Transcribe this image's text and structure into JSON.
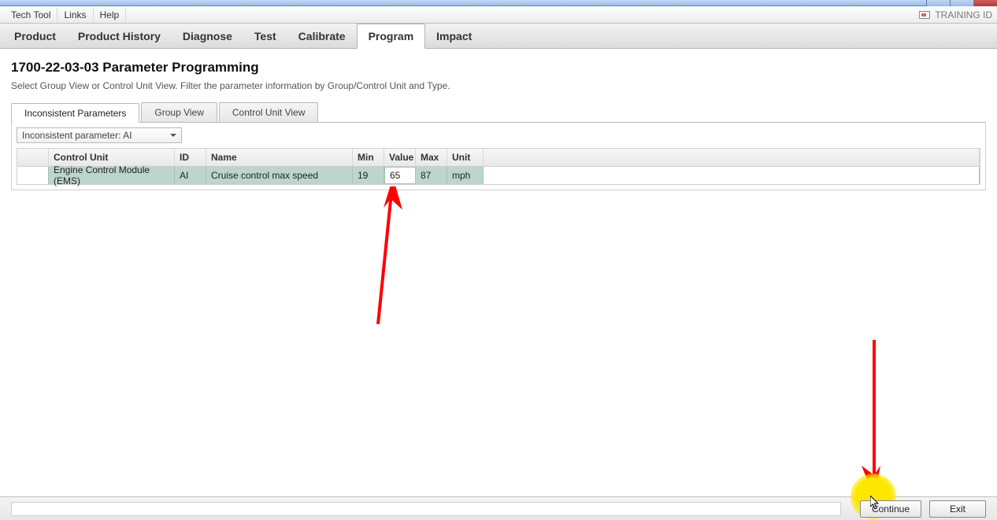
{
  "menubar": {
    "items": [
      "Tech Tool",
      "Links",
      "Help"
    ],
    "right_label": "TRAINING ID"
  },
  "nav": {
    "tabs": [
      "Product",
      "Product History",
      "Diagnose",
      "Test",
      "Calibrate",
      "Program",
      "Impact"
    ],
    "active_index": 5
  },
  "page": {
    "title": "1700-22-03-03 Parameter Programming",
    "subtitle": "Select Group View or Control Unit View. Filter the parameter information by Group/Control Unit and Type."
  },
  "subtabs": {
    "items": [
      "Inconsistent Parameters",
      "Group View",
      "Control Unit View"
    ],
    "active_index": 0
  },
  "filter": {
    "label": "Inconsistent parameter:  AI"
  },
  "table": {
    "columns": [
      "",
      "Control Unit",
      "ID",
      "Name",
      "Min",
      "Value",
      "Max",
      "Unit"
    ],
    "rows": [
      {
        "control_unit": "Engine Control Module (EMS)",
        "id": "AI",
        "name": "Cruise control max speed",
        "min": "19",
        "value": "65",
        "max": "87",
        "unit": "mph"
      }
    ]
  },
  "footer": {
    "continue": "Continue",
    "exit": "Exit"
  }
}
